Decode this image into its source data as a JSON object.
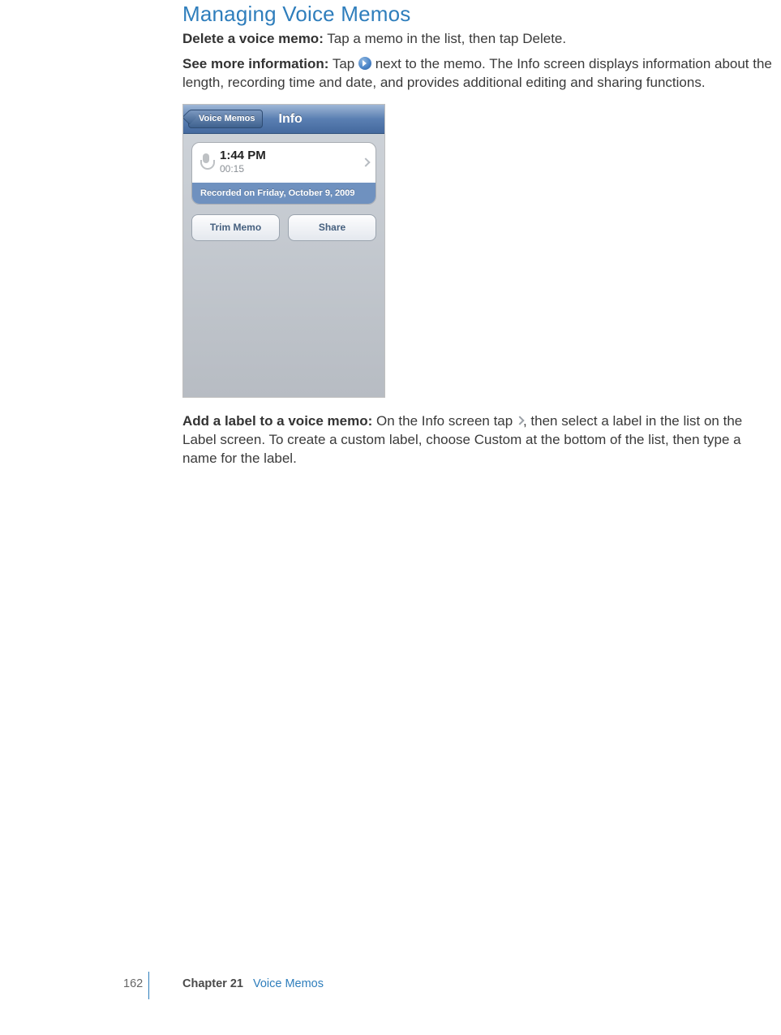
{
  "heading": "Managing Voice Memos",
  "para1": {
    "bold": "Delete a voice memo:",
    "rest": "  Tap a memo in the list, then tap Delete."
  },
  "para2": {
    "bold": "See more information:",
    "pre": "  Tap ",
    "post": " next to the memo. The Info screen displays information about the length, recording time and date, and provides additional editing and sharing functions."
  },
  "device": {
    "back_label": "Voice Memos",
    "title": "Info",
    "memo_time": "1:44 PM",
    "memo_duration": "00:15",
    "recorded_line": "Recorded on Friday, October 9, 2009",
    "btn_trim": "Trim Memo",
    "btn_share": "Share"
  },
  "para3": {
    "bold": "Add a label to a voice memo:",
    "pre": "  On the Info screen tap ",
    "post": ", then select a label in the list on the Label screen. To create a custom label, choose Custom at the bottom of the list, then type a name for the label."
  },
  "footer": {
    "page": "162",
    "chapter_label": "Chapter 21",
    "chapter_name": "Voice Memos"
  }
}
